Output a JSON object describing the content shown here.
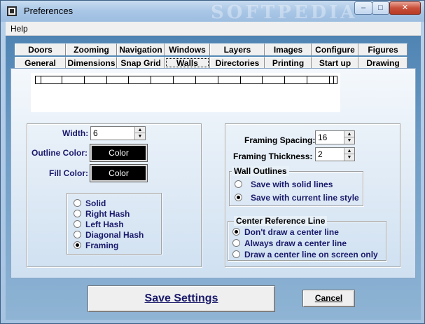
{
  "window": {
    "title": "Preferences",
    "watermark": "SOFTPEDIA",
    "min_glyph": "–",
    "max_glyph": "□",
    "close_glyph": "✕"
  },
  "menu": {
    "help": "Help"
  },
  "tabs": {
    "row1": [
      "Doors",
      "Zooming",
      "Navigation",
      "Windows",
      "Layers",
      "Images",
      "Configure",
      "Figures"
    ],
    "row2": [
      "General",
      "Dimensions",
      "Snap Grid",
      "Walls",
      "Directories",
      "Printing",
      "Start up",
      "Drawing"
    ],
    "active": "Walls"
  },
  "left": {
    "width_label": "Width:",
    "width_value": "6",
    "outline_label": "Outline Color:",
    "outline_btn": "Color",
    "fill_label": "Fill Color:",
    "fill_btn": "Color",
    "fill_options": [
      "Solid",
      "Right Hash",
      "Left Hash",
      "Diagonal Hash",
      "Framing"
    ],
    "fill_selected": "Framing"
  },
  "right": {
    "spacing_label": "Framing Spacing:",
    "spacing_value": "16",
    "thickness_label": "Framing Thickness:",
    "thickness_value": "2",
    "wall_outlines_legend": "Wall Outlines",
    "wall_outline_options": [
      "Save with solid lines",
      "Save with current line style"
    ],
    "wall_outline_selected": "Save with current line style",
    "center_line_legend": "Center Reference Line",
    "center_line_options": [
      "Don't draw a center line",
      "Always draw a center line",
      "Draw a center line on screen only"
    ],
    "center_line_selected": "Don't draw a center line"
  },
  "buttons": {
    "save": "Save Settings",
    "cancel": "Cancel"
  },
  "colors": {
    "accent_text": "#1a1a6b",
    "color_swatch": "#000000"
  }
}
